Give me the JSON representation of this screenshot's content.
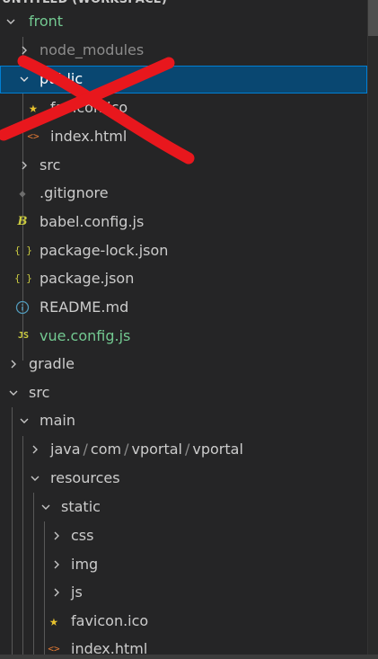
{
  "header": {
    "title": "UNTITLED (WORKSPACE)"
  },
  "tree": {
    "front": "front",
    "node_modules": "node_modules",
    "public": "public",
    "public_favicon": "favicon.ico",
    "public_index": "index.html",
    "front_src": "src",
    "gitignore": ".gitignore",
    "babel": "babel.config.js",
    "package_lock": "package-lock.json",
    "package_json": "package.json",
    "readme": "README.md",
    "vue_config": "vue.config.js",
    "gradle": "gradle",
    "src": "src",
    "main": "main",
    "java_path": [
      "java",
      "com",
      "vportal",
      "vportal"
    ],
    "java_sep": "/",
    "resources": "resources",
    "static": "static",
    "css": "css",
    "img": "img",
    "js": "js",
    "static_favicon": "favicon.ico",
    "static_index": "index.html"
  },
  "icons": {
    "babel_glyph": "B",
    "json_glyph": "{ }",
    "js_glyph": "JS",
    "html_glyph": "<>",
    "info_glyph": "i",
    "git_glyph": "◆",
    "star_glyph": "★"
  },
  "colors": {
    "background": "#252526",
    "selection": "#094771",
    "selection_border": "#007fd4",
    "modified_green": "#73c991",
    "ignored_gray": "#8c8c8c",
    "json_yellow": "#cbcb41",
    "html_orange": "#e37933",
    "info_blue": "#519aba",
    "star_yellow": "#e8c32e",
    "x_mark_red": "#e8171d"
  }
}
